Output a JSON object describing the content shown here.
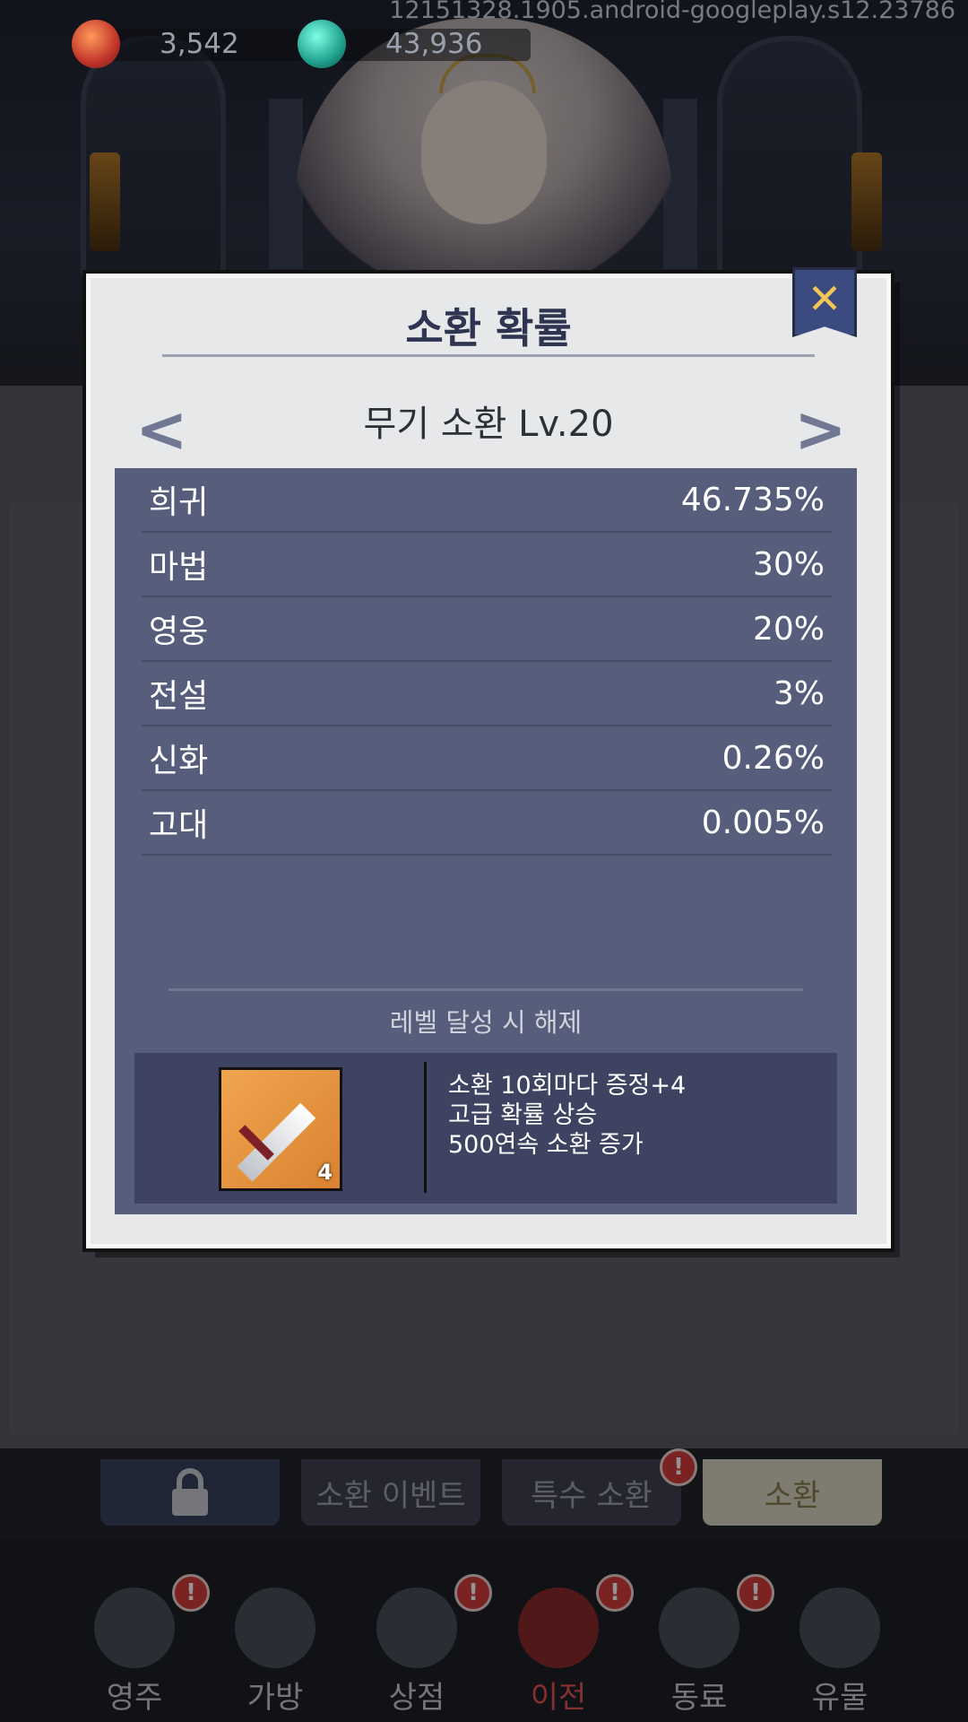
{
  "build": "12151328.1905.android-googleplay.s12.23786",
  "currencies": [
    {
      "icon": "red-gem-icon",
      "value": "3,542"
    },
    {
      "icon": "teal-gem-icon",
      "value": "43,936"
    }
  ],
  "modal": {
    "title": "소환 확률",
    "subtitle": "무기 소환 Lv.20",
    "prev_icon": "chevron-left-icon",
    "next_icon": "chevron-right-icon",
    "close_icon": "close-icon",
    "rates": [
      {
        "grade": "희귀",
        "rate": "46.735%"
      },
      {
        "grade": "마법",
        "rate": "30%"
      },
      {
        "grade": "영웅",
        "rate": "20%"
      },
      {
        "grade": "전설",
        "rate": "3%"
      },
      {
        "grade": "신화",
        "rate": "0.26%"
      },
      {
        "grade": "고대",
        "rate": "0.005%"
      }
    ],
    "unlock_label": "레벨 달성 시 해제",
    "reward": {
      "item_icon": "sword-icon",
      "item_count": "4",
      "lines": [
        "소환 10회마다 증정+4",
        "고급 확률 상승",
        "500연속 소환 증가"
      ]
    }
  },
  "tabs": [
    {
      "label": "",
      "icon": "lock-icon",
      "badge": ""
    },
    {
      "label": "소환 이벤트",
      "badge": ""
    },
    {
      "label": "특수 소환",
      "badge": "!"
    },
    {
      "label": "소환",
      "badge": ""
    }
  ],
  "nav": [
    {
      "label": "영주",
      "icon": "lord-icon",
      "badge": "!"
    },
    {
      "label": "가방",
      "icon": "bag-icon",
      "badge": ""
    },
    {
      "label": "상점",
      "icon": "shop-icon",
      "badge": "!"
    },
    {
      "label": "이전",
      "icon": "transfer-icon",
      "badge": "!"
    },
    {
      "label": "동료",
      "icon": "crown-icon",
      "badge": "!"
    },
    {
      "label": "유물",
      "icon": "pocket-watch-icon",
      "badge": ""
    }
  ],
  "colors": {
    "accent": "#3b4a7f",
    "active_nav": "#e35353",
    "badge": "#d43b3b"
  }
}
